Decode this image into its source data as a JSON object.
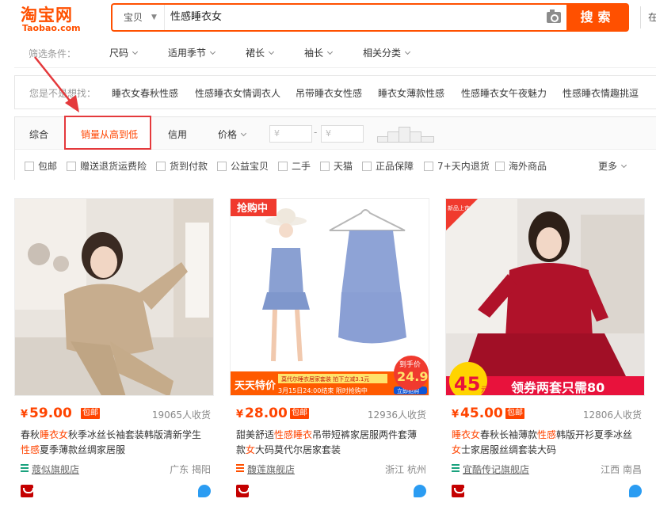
{
  "header": {
    "logo_text": "淘宝网",
    "logo_sub": "Taobao.com",
    "search_type": "宝贝",
    "search_value": "性感睡衣女",
    "search_button": "搜索",
    "extra": "在"
  },
  "filters": {
    "label": "筛选条件：",
    "items": [
      "尺码",
      "适用季节",
      "裙长",
      "袖长",
      "相关分类"
    ]
  },
  "related": {
    "label": "您是不是想找：",
    "items": [
      "睡衣女春秋性感",
      "性感睡衣女情调衣人",
      "吊带睡衣女性感",
      "睡衣女薄款性感",
      "性感睡衣女午夜魅力",
      "性感睡衣情趣挑逗"
    ]
  },
  "sort": {
    "items": [
      "综合",
      "销量从高到低",
      "信用",
      "价格"
    ],
    "active": "销量从高到低",
    "price_min_placeholder": "¥",
    "price_max_placeholder": "¥",
    "dash": "-",
    "checks": [
      "包邮",
      "赠送退货运费险",
      "货到付款",
      "公益宝贝",
      "二手",
      "天猫",
      "正品保障",
      "7+天内退货",
      "海外商品"
    ],
    "more": "更多"
  },
  "colors": {
    "accent": "#ff5000",
    "price": "#ff4400",
    "highlight_border": "#e4393c"
  },
  "products": [
    {
      "price": "59.00",
      "currency": "¥",
      "badge": "包邮",
      "sales": "19065人收货",
      "title_parts": [
        {
          "t": "春秋",
          "hl": false
        },
        {
          "t": "睡衣女",
          "hl": true
        },
        {
          "t": "秋季冰丝长袖套装韩版清新学生",
          "hl": false
        },
        {
          "t": "性感",
          "hl": true
        },
        {
          "t": "夏季薄款丝绸家居服",
          "hl": false
        }
      ],
      "shop": "蔻似旗舰店",
      "location": "广东 揭阳"
    },
    {
      "price": "28.00",
      "currency": "¥",
      "badge": "包邮",
      "sales": "12936人收货",
      "title_parts": [
        {
          "t": "甜美舒适",
          "hl": false
        },
        {
          "t": "性感睡衣",
          "hl": true
        },
        {
          "t": "吊带短裤家居服两件套薄款",
          "hl": false
        },
        {
          "t": "女",
          "hl": true
        },
        {
          "t": "大码莫代尔居家套装",
          "hl": false
        }
      ],
      "shop": "馥莲旗舰店",
      "location": "浙江 杭州",
      "image_texts": {
        "tag": "抢购中",
        "banner_left": "天天特价",
        "promo_top": "莫代尔睡衣居家套装 拍下立减3.1元",
        "promo_bottom": "3月15日24:00结束 限时抢购中",
        "promo_btn": "立即抢购",
        "hand_price_label": "到手价",
        "hand_price": "24.9"
      }
    },
    {
      "price": "45.00",
      "currency": "¥",
      "badge": "包邮",
      "sales": "12806人收货",
      "title_parts": [
        {
          "t": "睡衣女",
          "hl": true
        },
        {
          "t": "春秋长袖薄款",
          "hl": false
        },
        {
          "t": "性感",
          "hl": true
        },
        {
          "t": "韩版开衫夏季冰丝",
          "hl": false
        },
        {
          "t": "女",
          "hl": true
        },
        {
          "t": "士家居服丝绸套装大码",
          "hl": false
        }
      ],
      "shop": "宜酷传记旗舰店",
      "location": "江西 南昌",
      "image_texts": {
        "corner": "新品上市",
        "big_price": "45",
        "unit": "元",
        "banner": "领券两套只需80"
      }
    }
  ]
}
